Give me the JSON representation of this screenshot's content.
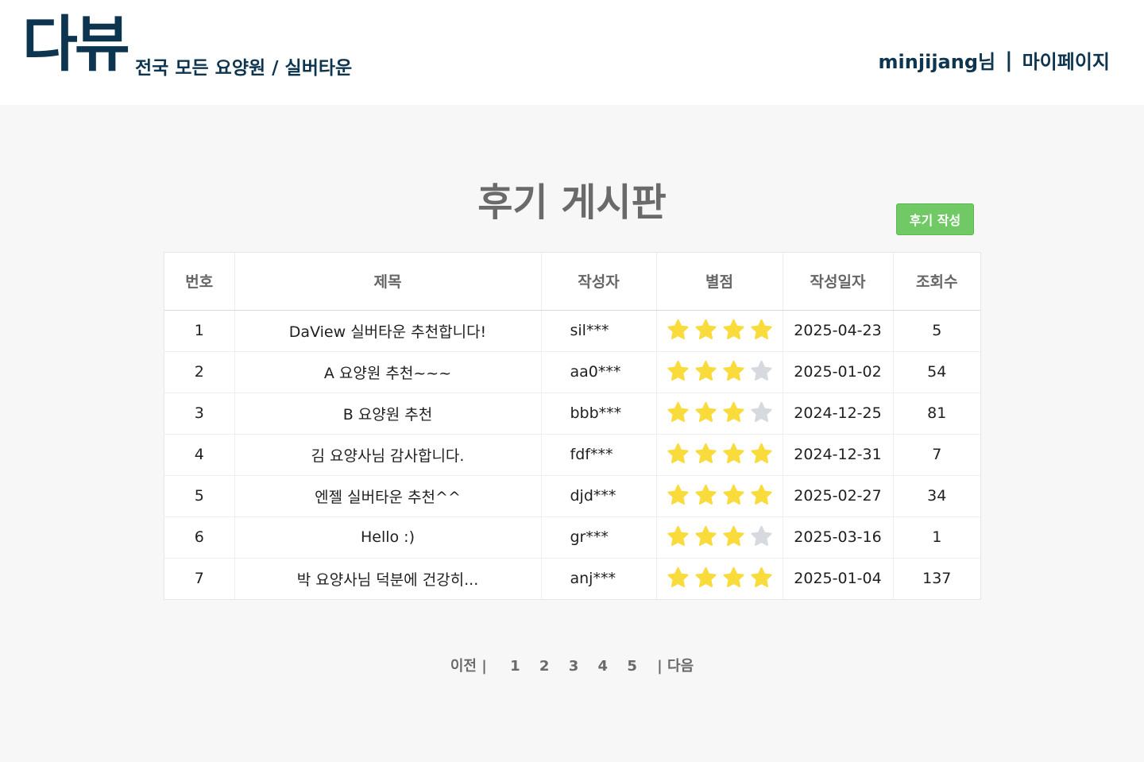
{
  "header": {
    "logo": "다뷰",
    "tagline": "전국 모든 요양원 / 실버타운",
    "user_label": "minjijang님",
    "separator": "|",
    "mypage_label": "마이페이지"
  },
  "board": {
    "title": "후기 게시판",
    "write_button": "후기 작성",
    "columns": [
      "번호",
      "제목",
      "작성자",
      "별점",
      "작성일자",
      "조회수"
    ],
    "rows": [
      {
        "no": "1",
        "title": "DaView 실버타운 추천합니다!",
        "writer": "sil***",
        "rating": 4,
        "date": "2025-04-23",
        "views": "5"
      },
      {
        "no": "2",
        "title": "A 요양원 추천~~~",
        "writer": "aa0***",
        "rating": 3,
        "date": "2025-01-02",
        "views": "54"
      },
      {
        "no": "3",
        "title": "B 요양원 추천",
        "writer": "bbb***",
        "rating": 3,
        "date": "2024-12-25",
        "views": "81"
      },
      {
        "no": "4",
        "title": "김 요양사님 감사합니다.",
        "writer": "fdf***",
        "rating": 4,
        "date": "2024-12-31",
        "views": "7"
      },
      {
        "no": "5",
        "title": "엔젤 실버타운 추천^^",
        "writer": "djd***",
        "rating": 4,
        "date": "2025-02-27",
        "views": "34"
      },
      {
        "no": "6",
        "title": "Hello :)",
        "writer": "gr***",
        "rating": 3,
        "date": "2025-03-16",
        "views": "1"
      },
      {
        "no": "7",
        "title": "박 요양사님 덕분에 건강히...",
        "writer": "anj***",
        "rating": 4,
        "date": "2025-01-04",
        "views": "137"
      }
    ],
    "max_rating": 4,
    "star_color": "#fadb3c",
    "star_empty_color": "#d6d9de"
  },
  "pagination": {
    "prev": "이전 |",
    "pages": [
      "1",
      "2",
      "3",
      "4",
      "5"
    ],
    "next": "| 다음"
  },
  "colors": {
    "brand": "#0d3550",
    "button": "#71c965",
    "background": "#f7f7f7"
  }
}
